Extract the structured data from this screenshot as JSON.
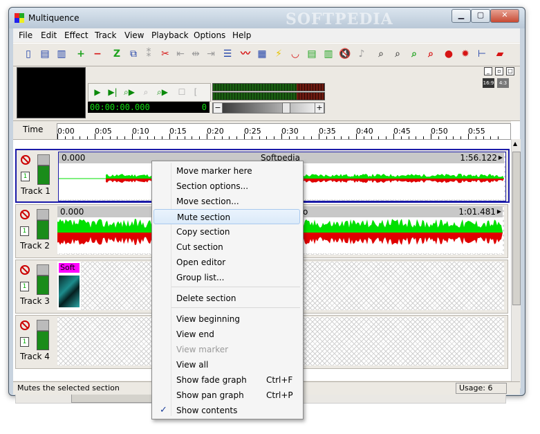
{
  "window": {
    "title": "Multiquence",
    "watermark": "SOFTPEDIA"
  },
  "menubar": [
    "File",
    "Edit",
    "Effect",
    "Track",
    "View",
    "Playback",
    "Options",
    "Help"
  ],
  "transport": {
    "time": "00:00:00.000",
    "counter": "0"
  },
  "ratio_buttons": [
    "16:9",
    "4:3"
  ],
  "timeline": {
    "label": "Time",
    "ticks": [
      "0:00",
      "0:05",
      "0:10",
      "0:15",
      "0:20",
      "0:25",
      "0:30",
      "0:35",
      "0:40",
      "0:45",
      "0:50",
      "0:55"
    ]
  },
  "tracks": [
    {
      "name": "Track 1",
      "number": "1",
      "start": "0.000",
      "title": "Softpedia",
      "length": "1:56.122"
    },
    {
      "name": "Track 2",
      "number": "1",
      "start": "0.000",
      "title": "o",
      "length": "1:01.481"
    },
    {
      "name": "Track 3",
      "number": "1",
      "clip_label": "Soft"
    },
    {
      "name": "Track 4",
      "number": "1"
    }
  ],
  "status": {
    "text": "Mutes the selected section",
    "usage": "Usage: 6"
  },
  "context_menu": {
    "items": [
      {
        "label": "Move marker here"
      },
      {
        "label": "Section options..."
      },
      {
        "label": "Move section..."
      },
      {
        "label": "Mute section"
      },
      {
        "label": "Copy section"
      },
      {
        "label": "Cut section"
      },
      {
        "label": "Open editor"
      },
      {
        "label": "Group list..."
      },
      {
        "label": "Delete section"
      },
      {
        "label": "View beginning"
      },
      {
        "label": "View end"
      },
      {
        "label": "View marker"
      },
      {
        "label": "View all"
      },
      {
        "label": "Show fade graph",
        "shortcut": "Ctrl+F"
      },
      {
        "label": "Show pan graph",
        "shortcut": "Ctrl+P"
      },
      {
        "label": "Show contents"
      }
    ],
    "highlighted": "Mute section",
    "disabled": [
      "View marker"
    ],
    "checked": [
      "Show contents"
    ]
  },
  "colors": {
    "wave_top": "#00e000",
    "wave_bottom": "#e00000",
    "selected_border": "#1a1aa8",
    "clip_label_bg": "#ff00ff"
  }
}
